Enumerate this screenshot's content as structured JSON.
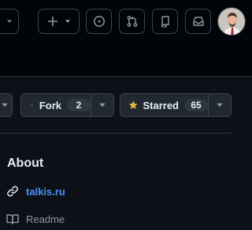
{
  "repo_actions": {
    "fork": {
      "label": "Fork",
      "count": "2"
    },
    "star": {
      "label": "Starred",
      "count": "65"
    }
  },
  "sidebar": {
    "about_title": "About",
    "website": "talkis.ru",
    "readme": "Readme"
  },
  "icons": {
    "header": [
      "chevron-down-icon",
      "plus-icon",
      "chevron-down-icon",
      "issues-icon",
      "pull-request-icon",
      "repo-icon",
      "inbox-icon"
    ],
    "star_color": "#e3b341"
  },
  "colors": {
    "background": "#0d1117",
    "header": "#010409",
    "link": "#4493f8"
  }
}
